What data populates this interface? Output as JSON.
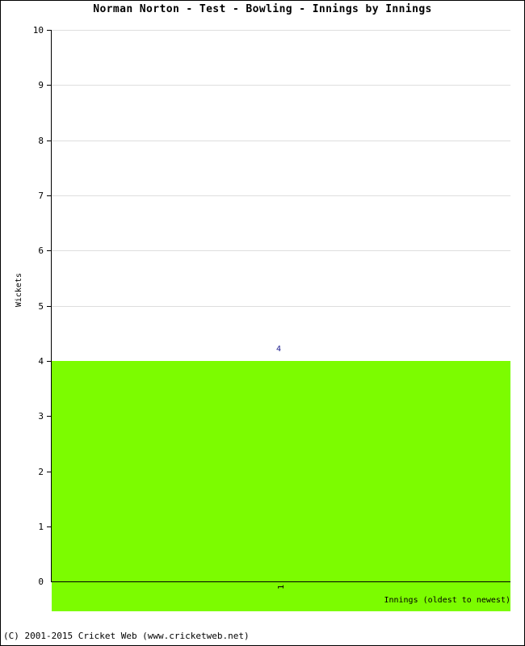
{
  "chart_data": {
    "type": "bar",
    "title": "Norman Norton - Test - Bowling - Innings by Innings",
    "xlabel": "Innings (oldest to newest)",
    "ylabel": "Wickets",
    "categories": [
      "1"
    ],
    "values": [
      4
    ],
    "data_labels": [
      "4"
    ],
    "ylim": [
      0,
      10
    ],
    "ytick_labels": [
      "0",
      "1",
      "2",
      "3",
      "4",
      "5",
      "6",
      "7",
      "8",
      "9",
      "10"
    ],
    "ytick_values": [
      0,
      1,
      2,
      3,
      4,
      5,
      6,
      7,
      8,
      9,
      10
    ],
    "grid": true,
    "legend": "none",
    "series": [
      {
        "name": "Wickets",
        "color": "#7CFC00",
        "values": [
          4
        ]
      }
    ],
    "colors": {
      "bar": "#7CFC00",
      "gridline": "#DEDEDE",
      "axis": "#000000",
      "data_label": "#1A1A8C",
      "background": "#FFFFFF",
      "frame": "#000000"
    }
  },
  "footer": {
    "copyright": "(C) 2001-2015 Cricket Web (www.cricketweb.net)"
  }
}
